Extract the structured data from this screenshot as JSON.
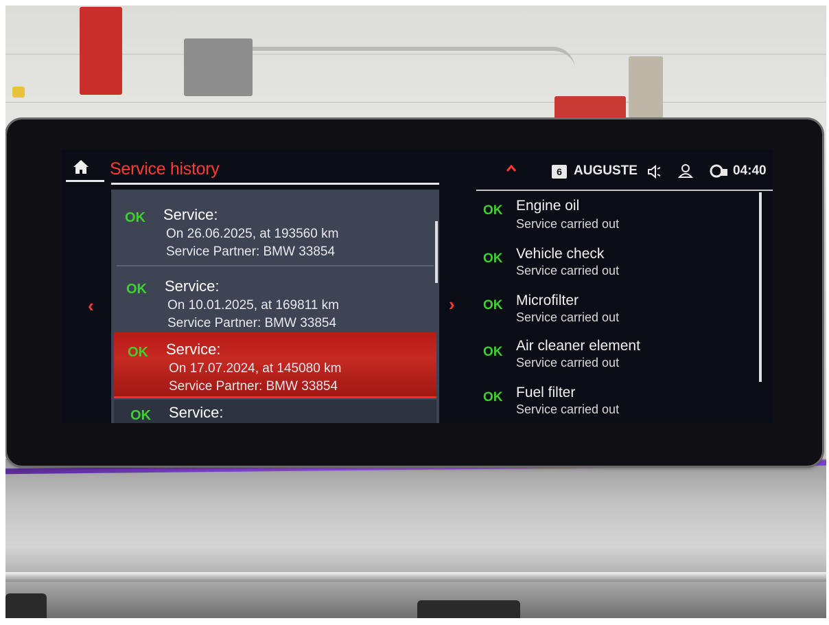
{
  "header": {
    "title": "Service history",
    "profile_number": "6",
    "profile_name": "AUGUSTE",
    "time": "04:40"
  },
  "service_list": {
    "items": [
      {
        "status": "OK",
        "title": "Service:",
        "date_line": "On 26.06.2025, at 193560 km",
        "partner_line": "Service Partner: BMW 33854"
      },
      {
        "status": "OK",
        "title": "Service:",
        "date_line": "On 10.01.2025, at 169811 km",
        "partner_line": "Service Partner: BMW 33854"
      },
      {
        "status": "OK",
        "title": "Service:",
        "date_line": "On 17.07.2024, at 145080 km",
        "partner_line": "Service Partner: BMW 33854"
      },
      {
        "status": "OK",
        "title": "Service:"
      }
    ],
    "selected_index": 2
  },
  "service_details": {
    "items": [
      {
        "status": "OK",
        "name": "Engine oil",
        "result": "Service carried out"
      },
      {
        "status": "OK",
        "name": "Vehicle check",
        "result": "Service carried out"
      },
      {
        "status": "OK",
        "name": "Microfilter",
        "result": "Service carried out"
      },
      {
        "status": "OK",
        "name": "Air cleaner element",
        "result": "Service carried out"
      },
      {
        "status": "OK",
        "name": "Fuel filter",
        "result": "Service carried out"
      }
    ]
  },
  "icons": {
    "home": "home-icon",
    "up": "chevron-up-icon",
    "volume": "speaker-icon",
    "user": "user-icon",
    "connectivity": "connected-car-icon",
    "prev": "chevron-left-icon",
    "next": "chevron-right-icon"
  },
  "colors": {
    "accent_red": "#ff3a32",
    "ok_green": "#3dd12d",
    "selection_red": "#c52a22",
    "ambient_purple": "#8e4de0"
  }
}
